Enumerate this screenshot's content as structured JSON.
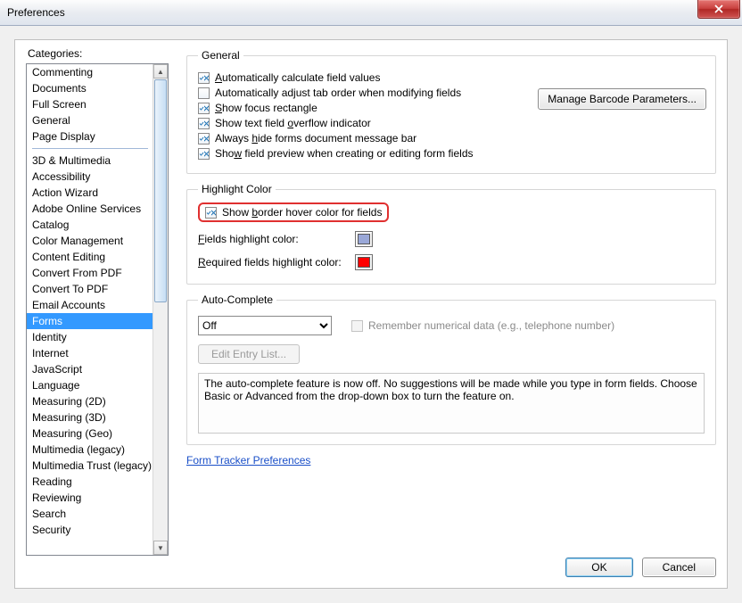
{
  "window": {
    "title": "Preferences"
  },
  "sidebar": {
    "label": "Categories:",
    "group1": [
      "Commenting",
      "Documents",
      "Full Screen",
      "General",
      "Page Display"
    ],
    "group2": [
      "3D & Multimedia",
      "Accessibility",
      "Action Wizard",
      "Adobe Online Services",
      "Catalog",
      "Color Management",
      "Content Editing",
      "Convert From PDF",
      "Convert To PDF",
      "Email Accounts",
      "Forms",
      "Identity",
      "Internet",
      "JavaScript",
      "Language",
      "Measuring (2D)",
      "Measuring (3D)",
      "Measuring (Geo)",
      "Multimedia (legacy)",
      "Multimedia Trust (legacy)",
      "Reading",
      "Reviewing",
      "Search",
      "Security"
    ],
    "selected": "Forms"
  },
  "general": {
    "legend": "General",
    "auto_calc": "Automatically calculate field values",
    "auto_tab": "Automatically adjust tab order when modifying fields",
    "focus_rect": "Show focus rectangle",
    "overflow": "Show text field overflow indicator",
    "hide_bar": "Always hide forms document message bar",
    "preview": "Show field preview when creating or editing form fields",
    "manage_btn": "Manage Barcode Parameters..."
  },
  "highlight": {
    "legend": "Highlight Color",
    "hover": "Show border hover color for fields",
    "fields_label": "Fields highlight color:",
    "required_label": "Required fields highlight color:",
    "fields_color": "#9aa8d8",
    "required_color": "#ff0000"
  },
  "autocomplete": {
    "legend": "Auto-Complete",
    "mode": "Off",
    "remember": "Remember numerical data (e.g., telephone number)",
    "edit_btn": "Edit Entry List...",
    "description": "The auto-complete feature is now off. No suggestions will be made while you type in form fields. Choose Basic or Advanced from the drop-down box to turn the feature on."
  },
  "link": {
    "label": "Form Tracker Preferences"
  },
  "footer": {
    "ok": "OK",
    "cancel": "Cancel"
  }
}
